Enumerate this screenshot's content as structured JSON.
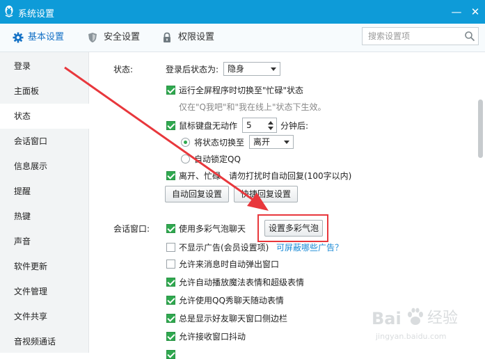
{
  "window": {
    "title": "系统设置",
    "minimize_glyph": "—",
    "close_glyph": "✕"
  },
  "tabs": [
    {
      "label": "基本设置",
      "icon": "gear-icon",
      "active": true
    },
    {
      "label": "安全设置",
      "icon": "shield-icon",
      "active": false
    },
    {
      "label": "权限设置",
      "icon": "lock-icon",
      "active": false
    }
  ],
  "search": {
    "placeholder": "搜索设置项",
    "icon": "search-icon"
  },
  "sidebar": {
    "items": [
      {
        "label": "登录"
      },
      {
        "label": "主面板"
      },
      {
        "label": "状态",
        "active": true
      },
      {
        "label": "会话窗口"
      },
      {
        "label": "信息展示"
      },
      {
        "label": "提醒"
      },
      {
        "label": "热键"
      },
      {
        "label": "声音"
      },
      {
        "label": "软件更新"
      },
      {
        "label": "文件管理"
      },
      {
        "label": "文件共享"
      },
      {
        "label": "音视频通话"
      }
    ]
  },
  "status_section": {
    "heading": "状态:",
    "login_status_label": "登录后状态为:",
    "login_status_value": "隐身",
    "fullscreen_busy": {
      "label": "运行全屏程序时切换至\"忙碌\"状态",
      "checked": true
    },
    "fullscreen_note": "仅在\"Q我吧\"和\"我在线上\"状态下生效。",
    "idle": {
      "label": "鼠标键盘无动作",
      "checked": true,
      "minutes": "5",
      "suffix": "分钟后:"
    },
    "switch_status": {
      "label": "将状态切换至",
      "selected": true,
      "value": "离开"
    },
    "auto_lock": {
      "label": "自动锁定QQ",
      "selected": false
    },
    "auto_reply": {
      "label": "离开、忙碌、请勿打扰时自动回复(100字以内)",
      "checked": true
    },
    "buttons": {
      "auto_reply_settings": "自动回复设置",
      "quick_reply_settings": "快捷回复设置"
    }
  },
  "chat_section": {
    "heading": "会话窗口:",
    "colorful_bubbles": {
      "label": "使用多彩气泡聊天",
      "checked": true
    },
    "bubble_button": "设置多彩气泡",
    "no_ads": {
      "label": "不显示广告(会员设置项)",
      "checked": false
    },
    "ads_link": "可屏蔽哪些广告？",
    "auto_popup": {
      "label": "允许来消息时自动弹出窗口",
      "checked": false
    },
    "magic_emoji": {
      "label": "允许自动播放魔法表情和超级表情",
      "checked": true
    },
    "qq_show": {
      "label": "允许使用QQ秀聊天随动表情",
      "checked": true
    },
    "sidebar_always": {
      "label": "总是显示好友聊天窗口侧边栏",
      "checked": true
    },
    "shake": {
      "label": "允许接收窗口抖动",
      "checked": true
    }
  },
  "watermark": {
    "brand_left": "Bai",
    "brand_right": "经验",
    "url": "jingyan.baidu.com"
  },
  "colors": {
    "titlebar": "#0e9bd8",
    "accent": "#1572c6",
    "checkbox_on": "#2fa84f",
    "highlight": "#e8373c"
  }
}
